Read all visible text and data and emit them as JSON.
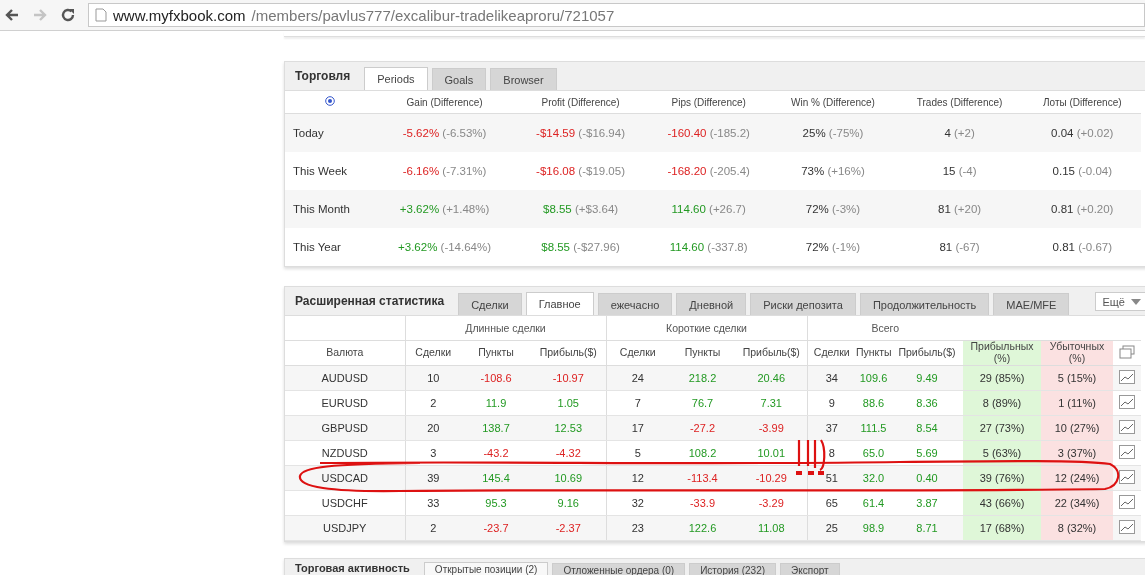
{
  "browser": {
    "url_host": "www.myfxbook.com",
    "url_path": "/members/pavlus777/excalibur-tradelikeaproru/721057",
    "forward_disabled": true
  },
  "trading": {
    "title": "Торговля",
    "tabs": [
      {
        "label": "Periods",
        "selected": true
      },
      {
        "label": "Goals",
        "selected": false
      },
      {
        "label": "Browser",
        "selected": false
      }
    ],
    "columns": [
      "Gain (Difference)",
      "Profit (Difference)",
      "Pips (Difference)",
      "Win % (Difference)",
      "Trades (Difference)",
      "Лоты (Difference)"
    ],
    "rows": [
      {
        "label": "Today",
        "cells": [
          {
            "value": "-5.62%",
            "diff": "(-6.53%)",
            "kind": "loss"
          },
          {
            "value": "-$14.59",
            "diff": "(-$16.94)",
            "kind": "loss"
          },
          {
            "value": "-160.40",
            "diff": "(-185.2)",
            "kind": "loss"
          },
          {
            "value": "25%",
            "diff": "(-75%)",
            "kind": "plain"
          },
          {
            "value": "4",
            "diff": "(+2)",
            "kind": "plain"
          },
          {
            "value": "0.04",
            "diff": "(+0.02)",
            "kind": "plain"
          }
        ]
      },
      {
        "label": "This Week",
        "cells": [
          {
            "value": "-6.16%",
            "diff": "(-7.31%)",
            "kind": "loss"
          },
          {
            "value": "-$16.08",
            "diff": "(-$19.05)",
            "kind": "loss"
          },
          {
            "value": "-168.20",
            "diff": "(-205.4)",
            "kind": "loss"
          },
          {
            "value": "73%",
            "diff": "(+16%)",
            "kind": "plain"
          },
          {
            "value": "15",
            "diff": "(-4)",
            "kind": "plain"
          },
          {
            "value": "0.15",
            "diff": "(-0.04)",
            "kind": "plain"
          }
        ]
      },
      {
        "label": "This Month",
        "cells": [
          {
            "value": "+3.62%",
            "diff": "(+1.48%)",
            "kind": "gain"
          },
          {
            "value": "$8.55",
            "diff": "(+$3.64)",
            "kind": "gain"
          },
          {
            "value": "114.60",
            "diff": "(+26.7)",
            "kind": "gain"
          },
          {
            "value": "72%",
            "diff": "(-3%)",
            "kind": "plain"
          },
          {
            "value": "81",
            "diff": "(+20)",
            "kind": "plain"
          },
          {
            "value": "0.81",
            "diff": "(+0.20)",
            "kind": "plain"
          }
        ]
      },
      {
        "label": "This Year",
        "cells": [
          {
            "value": "+3.62%",
            "diff": "(-14.64%)",
            "kind": "gain"
          },
          {
            "value": "$8.55",
            "diff": "(-$27.96)",
            "kind": "gain"
          },
          {
            "value": "114.60",
            "diff": "(-337.8)",
            "kind": "gain"
          },
          {
            "value": "72%",
            "diff": "(-1%)",
            "kind": "plain"
          },
          {
            "value": "81",
            "diff": "(-67)",
            "kind": "plain"
          },
          {
            "value": "0.81",
            "diff": "(-0.67)",
            "kind": "plain"
          }
        ]
      }
    ]
  },
  "extended": {
    "title": "Расширенная статистика",
    "tabs": [
      {
        "label": "Сделки",
        "selected": false
      },
      {
        "label": "Главное",
        "selected": true
      },
      {
        "label": "ежечасно",
        "selected": false
      },
      {
        "label": "Дневной",
        "selected": false
      },
      {
        "label": "Риски депозита",
        "selected": false
      },
      {
        "label": "Продолжительность",
        "selected": false
      },
      {
        "label": "MAE/MFE",
        "selected": false
      }
    ],
    "more": "Ещё",
    "groups": [
      "Длинные сделки",
      "Короткие сделки",
      "Всего"
    ],
    "columns": [
      {
        "label": "Валюта",
        "kind": "plain"
      },
      {
        "label": "Сделки",
        "kind": "plain"
      },
      {
        "label": "Пункты",
        "kind": "plain"
      },
      {
        "label": "Прибыль($)",
        "kind": "plain"
      },
      {
        "label": "Сделки",
        "kind": "plain"
      },
      {
        "label": "Пункты",
        "kind": "plain"
      },
      {
        "label": "Прибыль($)",
        "kind": "plain"
      },
      {
        "label": "Сделки",
        "kind": "plain"
      },
      {
        "label": "Пункты",
        "kind": "plain"
      },
      {
        "label": "Прибыль($)",
        "kind": "plain"
      },
      {
        "label": "Прибыльных (%)",
        "kind": "won"
      },
      {
        "label": "Убыточных (%)",
        "kind": "lost"
      }
    ],
    "rows": [
      {
        "cells": [
          {
            "text": "AUDUSD",
            "kind": "plain"
          },
          {
            "text": "10",
            "kind": "plain"
          },
          {
            "text": "-108.6",
            "kind": "loss"
          },
          {
            "text": "-10.97",
            "kind": "loss"
          },
          {
            "text": "24",
            "kind": "plain"
          },
          {
            "text": "218.2",
            "kind": "gain"
          },
          {
            "text": "20.46",
            "kind": "gain"
          },
          {
            "text": "34",
            "kind": "plain"
          },
          {
            "text": "109.6",
            "kind": "gain"
          },
          {
            "text": "9.49",
            "kind": "gain"
          },
          {
            "text": "29 (85%)",
            "kind": "plain"
          },
          {
            "text": "5 (15%)",
            "kind": "plain"
          }
        ]
      },
      {
        "cells": [
          {
            "text": "EURUSD",
            "kind": "plain"
          },
          {
            "text": "2",
            "kind": "plain"
          },
          {
            "text": "11.9",
            "kind": "gain"
          },
          {
            "text": "1.05",
            "kind": "gain"
          },
          {
            "text": "7",
            "kind": "plain"
          },
          {
            "text": "76.7",
            "kind": "gain"
          },
          {
            "text": "7.31",
            "kind": "gain"
          },
          {
            "text": "9",
            "kind": "plain"
          },
          {
            "text": "88.6",
            "kind": "gain"
          },
          {
            "text": "8.36",
            "kind": "gain"
          },
          {
            "text": "8 (89%)",
            "kind": "plain"
          },
          {
            "text": "1 (11%)",
            "kind": "plain"
          }
        ]
      },
      {
        "cells": [
          {
            "text": "GBPUSD",
            "kind": "plain"
          },
          {
            "text": "20",
            "kind": "plain"
          },
          {
            "text": "138.7",
            "kind": "gain"
          },
          {
            "text": "12.53",
            "kind": "gain"
          },
          {
            "text": "17",
            "kind": "plain"
          },
          {
            "text": "-27.2",
            "kind": "loss"
          },
          {
            "text": "-3.99",
            "kind": "loss"
          },
          {
            "text": "37",
            "kind": "plain"
          },
          {
            "text": "111.5",
            "kind": "gain"
          },
          {
            "text": "8.54",
            "kind": "gain"
          },
          {
            "text": "27 (73%)",
            "kind": "plain"
          },
          {
            "text": "10 (27%)",
            "kind": "plain"
          }
        ]
      },
      {
        "cells": [
          {
            "text": "NZDUSD",
            "kind": "plain"
          },
          {
            "text": "3",
            "kind": "plain"
          },
          {
            "text": "-43.2",
            "kind": "loss"
          },
          {
            "text": "-4.32",
            "kind": "loss"
          },
          {
            "text": "5",
            "kind": "plain"
          },
          {
            "text": "108.2",
            "kind": "gain"
          },
          {
            "text": "10.01",
            "kind": "gain"
          },
          {
            "text": "8",
            "kind": "plain"
          },
          {
            "text": "65.0",
            "kind": "gain"
          },
          {
            "text": "5.69",
            "kind": "gain"
          },
          {
            "text": "5 (63%)",
            "kind": "plain"
          },
          {
            "text": "3 (37%)",
            "kind": "plain"
          }
        ]
      },
      {
        "cells": [
          {
            "text": "USDCAD",
            "kind": "plain"
          },
          {
            "text": "39",
            "kind": "plain"
          },
          {
            "text": "145.4",
            "kind": "gain"
          },
          {
            "text": "10.69",
            "kind": "gain"
          },
          {
            "text": "12",
            "kind": "plain"
          },
          {
            "text": "-113.4",
            "kind": "loss"
          },
          {
            "text": "-10.29",
            "kind": "loss"
          },
          {
            "text": "51",
            "kind": "plain"
          },
          {
            "text": "32.0",
            "kind": "gain"
          },
          {
            "text": "0.40",
            "kind": "gain"
          },
          {
            "text": "39 (76%)",
            "kind": "plain"
          },
          {
            "text": "12 (24%)",
            "kind": "plain"
          }
        ]
      },
      {
        "cells": [
          {
            "text": "USDCHF",
            "kind": "plain"
          },
          {
            "text": "33",
            "kind": "plain"
          },
          {
            "text": "95.3",
            "kind": "gain"
          },
          {
            "text": "9.16",
            "kind": "gain"
          },
          {
            "text": "32",
            "kind": "plain"
          },
          {
            "text": "-33.9",
            "kind": "loss"
          },
          {
            "text": "-3.29",
            "kind": "loss"
          },
          {
            "text": "65",
            "kind": "plain"
          },
          {
            "text": "61.4",
            "kind": "gain"
          },
          {
            "text": "3.87",
            "kind": "gain"
          },
          {
            "text": "43 (66%)",
            "kind": "plain"
          },
          {
            "text": "22 (34%)",
            "kind": "plain"
          }
        ]
      },
      {
        "cells": [
          {
            "text": "USDJPY",
            "kind": "plain"
          },
          {
            "text": "2",
            "kind": "plain"
          },
          {
            "text": "-23.7",
            "kind": "loss"
          },
          {
            "text": "-2.37",
            "kind": "loss"
          },
          {
            "text": "23",
            "kind": "plain"
          },
          {
            "text": "122.6",
            "kind": "gain"
          },
          {
            "text": "11.08",
            "kind": "gain"
          },
          {
            "text": "25",
            "kind": "plain"
          },
          {
            "text": "98.9",
            "kind": "gain"
          },
          {
            "text": "8.71",
            "kind": "gain"
          },
          {
            "text": "17 (68%)",
            "kind": "plain"
          },
          {
            "text": "8 (32%)",
            "kind": "plain"
          }
        ]
      }
    ]
  },
  "activity": {
    "title": "Торговая активность",
    "tabs": [
      {
        "label": "Открытые позиции (2)",
        "selected": true
      },
      {
        "label": "Отложенные ордера (0)",
        "selected": false
      },
      {
        "label": "История (232)",
        "selected": false
      },
      {
        "label": "Экспорт",
        "selected": false
      }
    ]
  }
}
